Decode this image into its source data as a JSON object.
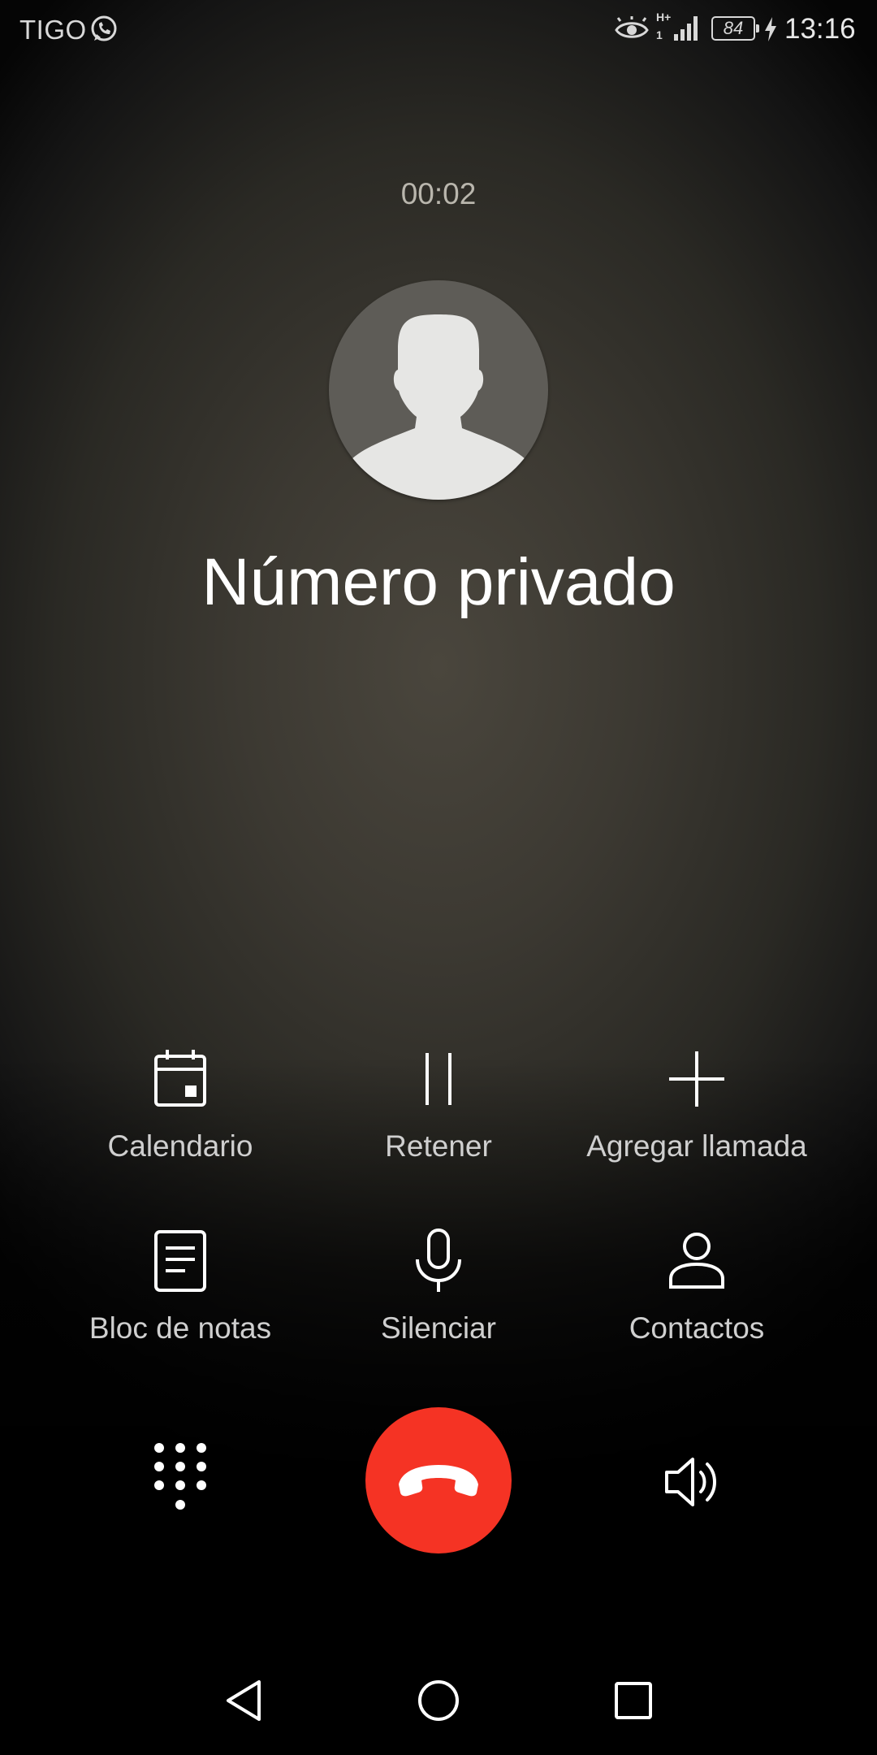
{
  "status_bar": {
    "carrier": "TIGO",
    "network_type_top": "H+",
    "network_type_bottom": "1",
    "battery_level": "84",
    "time": "13:16",
    "icons": [
      "whatsapp-icon",
      "eye-comfort-icon",
      "signal-icon",
      "battery-icon",
      "charging-icon"
    ]
  },
  "call": {
    "timer": "00:02",
    "caller_name": "Número privado",
    "avatar_icon": "default-avatar-icon"
  },
  "actions": [
    {
      "label": "Calendario",
      "icon": "calendar-icon"
    },
    {
      "label": "Retener",
      "icon": "pause-icon"
    },
    {
      "label": "Agregar llamada",
      "icon": "plus-icon"
    },
    {
      "label": "Bloc de notas",
      "icon": "notepad-icon"
    },
    {
      "label": "Silenciar",
      "icon": "microphone-icon"
    },
    {
      "label": "Contactos",
      "icon": "contact-icon"
    }
  ],
  "controls": {
    "dialpad_icon": "dialpad-icon",
    "end_call_icon": "end-call-icon",
    "speaker_icon": "speaker-icon"
  },
  "nav": {
    "icons": [
      "back-icon",
      "home-icon",
      "recents-icon"
    ]
  },
  "colors": {
    "end_call": "#f53324",
    "label": "#cfcfcf",
    "timer": "#b9b6ad"
  }
}
